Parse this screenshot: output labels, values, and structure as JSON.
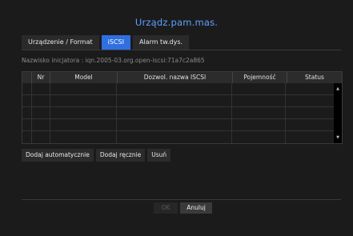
{
  "window": {
    "title": "Urządz.pam.mas."
  },
  "tabs": [
    {
      "label": "Urządzenie / Format",
      "active": false
    },
    {
      "label": "iSCSI",
      "active": true
    },
    {
      "label": "Alarm tw.dys.",
      "active": false
    }
  ],
  "initiator": {
    "label": "Nazwisko inicjatora : ",
    "value": "iqn.2005-03.org.open-iscsi:71a7c2a865"
  },
  "table": {
    "columns": [
      "",
      "Nr",
      "Model",
      "Dozwol. nazwa ISCSI",
      "Pojemność",
      "Status"
    ],
    "rows": [
      [],
      [],
      [],
      [],
      []
    ]
  },
  "actions": {
    "auto_add": "Dodaj automatycznie",
    "manual_add": "Dodaj ręcznie",
    "delete": "Usuń"
  },
  "footer": {
    "ok": "OK",
    "cancel": "Anuluj"
  },
  "colors": {
    "accent": "#2f6fe0",
    "title": "#5fa0ff"
  },
  "icons": {
    "scroll_up": "triangle-up",
    "scroll_down": "triangle-down"
  }
}
